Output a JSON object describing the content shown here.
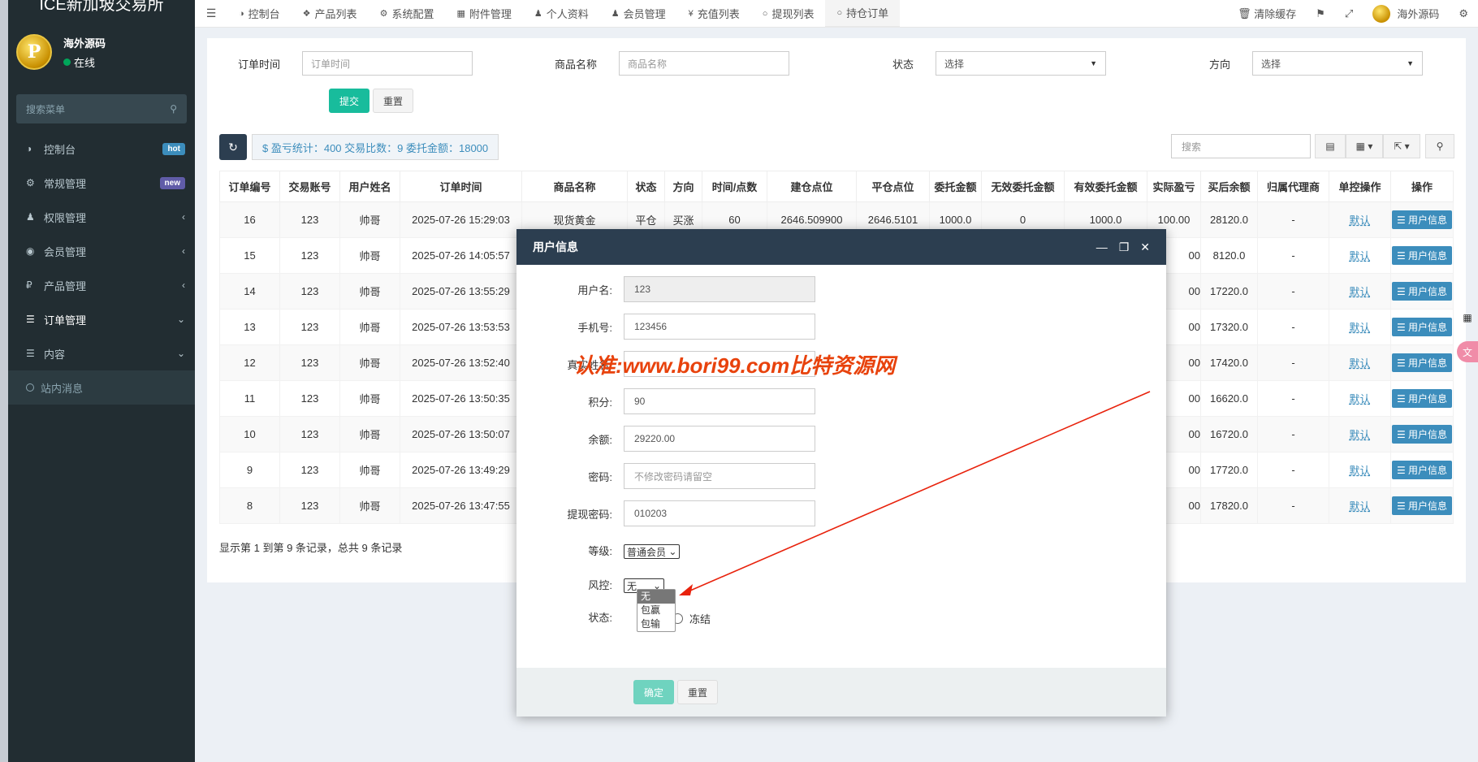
{
  "brand": "ICE新加坡交易所",
  "user": {
    "name": "海外源码",
    "status": "在线"
  },
  "sidebar": {
    "search_placeholder": "搜索菜单",
    "items": [
      {
        "label": "控制台",
        "icon": "dashboard-icon",
        "badge": "hot"
      },
      {
        "label": "常规管理",
        "icon": "cogs-icon",
        "badge": "new"
      },
      {
        "label": "权限管理",
        "icon": "group-icon",
        "chevron": "‹"
      },
      {
        "label": "会员管理",
        "icon": "user-circle-icon",
        "chevron": "‹"
      },
      {
        "label": "产品管理",
        "icon": "ruble-icon",
        "chevron": "‹"
      },
      {
        "label": "订单管理",
        "icon": "list-icon",
        "chevron": "⌄"
      },
      {
        "label": "内容",
        "icon": "list-icon",
        "chevron": "⌄"
      }
    ],
    "sub_items": [
      {
        "label": "站内消息"
      }
    ]
  },
  "topnav": {
    "tabs": [
      "控制台",
      "产品列表",
      "系统配置",
      "附件管理",
      "个人资料",
      "会员管理",
      "充值列表",
      "提现列表",
      "持仓订单"
    ],
    "clear_cache": "清除缓存",
    "admin_name": "海外源码"
  },
  "filters": {
    "order_time_label": "订单时间",
    "order_time_placeholder": "订单时间",
    "product_label": "商品名称",
    "product_placeholder": "商品名称",
    "status_label": "状态",
    "status_value": "选择",
    "direction_label": "方向",
    "direction_value": "选择",
    "submit": "提交",
    "reset": "重置"
  },
  "toolbar": {
    "stats": "$ 盈亏统计：400 交易比数：9 委托金额：18000",
    "search_placeholder": "搜索"
  },
  "table": {
    "headers": [
      "订单编号",
      "交易账号",
      "用户姓名",
      "订单时间",
      "商品名称",
      "状态",
      "方向",
      "时间/点数",
      "建仓点位",
      "平仓点位",
      "委托金额",
      "无效委托金额",
      "有效委托金额",
      "实际盈亏",
      "买后余额",
      "归属代理商",
      "单控操作",
      "操作"
    ],
    "first_row": {
      "id": "16",
      "account": "123",
      "name": "帅哥",
      "time": "2025-07-26 15:29:03",
      "product": "现货黄金",
      "status": "平仓",
      "direction": "买涨",
      "points": "60",
      "open": "2646.509900",
      "close": "2646.5101",
      "amount": "1000.0",
      "invalid": "0",
      "valid": "1000.0",
      "pnl": "100.00",
      "balance": "28120.0",
      "agent": "-",
      "control": "默认",
      "action": "用户信息"
    },
    "rows": [
      {
        "id": "15",
        "account": "123",
        "name": "帅哥",
        "time": "2025-07-26 14:05:57",
        "pnl_tail": "00",
        "balance": "8120.0",
        "agent": "-",
        "control": "默认",
        "action": "用户信息"
      },
      {
        "id": "14",
        "account": "123",
        "name": "帅哥",
        "time": "2025-07-26 13:55:29",
        "pnl_tail": "00",
        "balance": "17220.0",
        "agent": "-",
        "control": "默认",
        "action": "用户信息"
      },
      {
        "id": "13",
        "account": "123",
        "name": "帅哥",
        "time": "2025-07-26 13:53:53",
        "pnl_tail": "00",
        "balance": "17320.0",
        "agent": "-",
        "control": "默认",
        "action": "用户信息"
      },
      {
        "id": "12",
        "account": "123",
        "name": "帅哥",
        "time": "2025-07-26 13:52:40",
        "pnl_tail": "00",
        "balance": "17420.0",
        "agent": "-",
        "control": "默认",
        "action": "用户信息"
      },
      {
        "id": "11",
        "account": "123",
        "name": "帅哥",
        "time": "2025-07-26 13:50:35",
        "pnl_tail": "00",
        "balance": "16620.0",
        "agent": "-",
        "control": "默认",
        "action": "用户信息"
      },
      {
        "id": "10",
        "account": "123",
        "name": "帅哥",
        "time": "2025-07-26 13:50:07",
        "pnl_tail": "00",
        "balance": "16720.0",
        "agent": "-",
        "control": "默认",
        "action": "用户信息"
      },
      {
        "id": "9",
        "account": "123",
        "name": "帅哥",
        "time": "2025-07-26 13:49:29",
        "pnl_tail": "00",
        "balance": "17720.0",
        "agent": "-",
        "control": "默认",
        "action": "用户信息"
      },
      {
        "id": "8",
        "account": "123",
        "name": "帅哥",
        "time": "2025-07-26 13:47:55",
        "pnl_tail": "00",
        "balance": "17820.0",
        "agent": "-",
        "control": "默认",
        "action": "用户信息"
      }
    ],
    "pagination": "显示第 1 到第 9 条记录，总共 9 条记录"
  },
  "modal": {
    "title": "用户信息",
    "username_label": "用户名:",
    "username": "123",
    "phone_label": "手机号:",
    "phone": "123456",
    "realname_label": "真实姓名:",
    "points_label": "积分:",
    "points": "90",
    "balance_label": "余额:",
    "balance": "29220.00",
    "password_label": "密码:",
    "password_placeholder": "不修改密码请留空",
    "withdraw_pwd_label": "提现密码:",
    "withdraw_pwd": "010203",
    "level_label": "等级:",
    "level": "普通会员",
    "risk_label": "风控:",
    "risk": "无",
    "risk_options": [
      "无",
      "包赢",
      "包输"
    ],
    "status_label": "状态:",
    "status_freeze": "冻结",
    "confirm": "确定",
    "reset": "重置"
  },
  "watermark": "认准:www.bori99.com比特资源网",
  "colors": {
    "sidebar_bg": "#222d32",
    "header_bg": "#2c3e50",
    "success": "#18bc9c",
    "danger": "#e74c3c",
    "info": "#3c8dbc"
  }
}
